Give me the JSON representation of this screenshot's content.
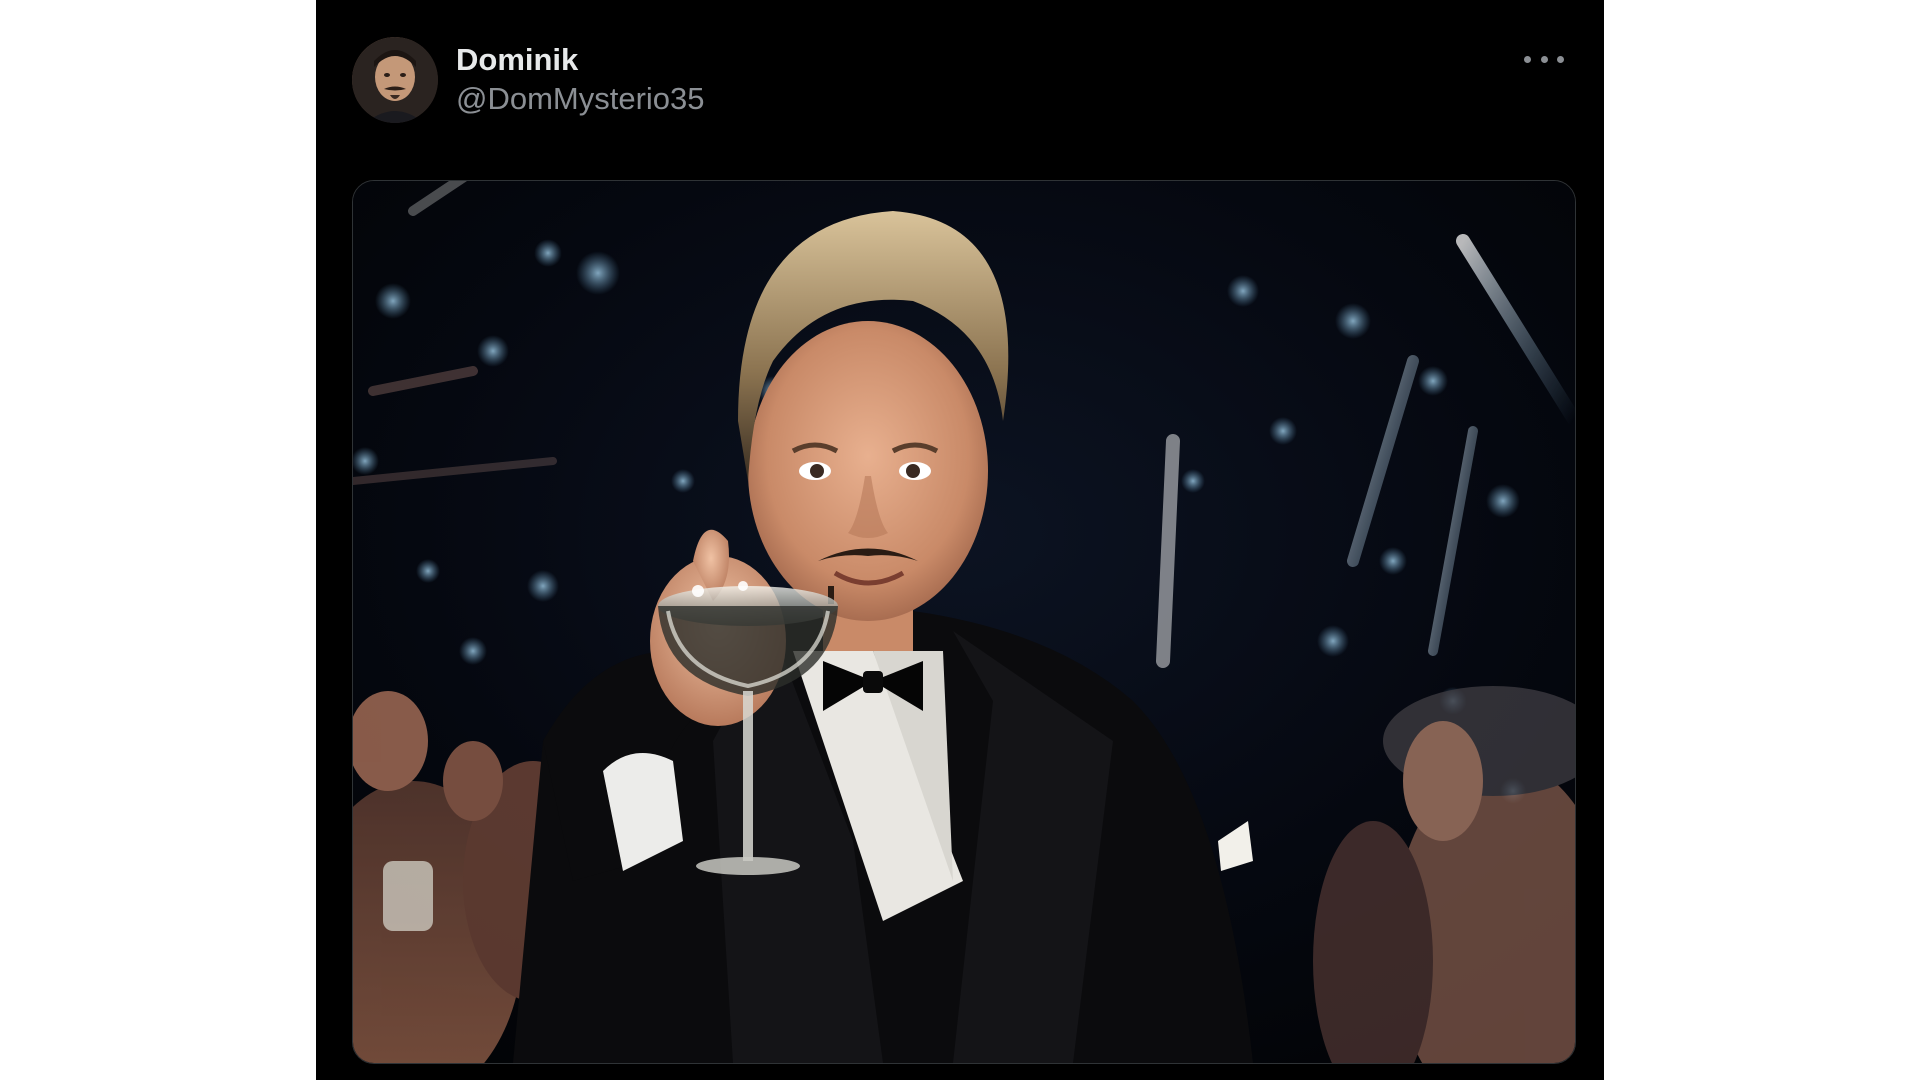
{
  "post": {
    "author": {
      "display_name": "Dominik",
      "handle": "@DomMysterio35",
      "avatar_icon": "profile-avatar"
    },
    "more_icon": "more-horizontal-icon",
    "media": {
      "kind": "photo",
      "subject": "man in black tuxedo raising a champagne coupe, fireworks and party crowd behind"
    }
  },
  "colors": {
    "background": "#000000",
    "display_name": "#e7e9ea",
    "handle": "#8b8f94",
    "media_border": "#2f3336"
  }
}
